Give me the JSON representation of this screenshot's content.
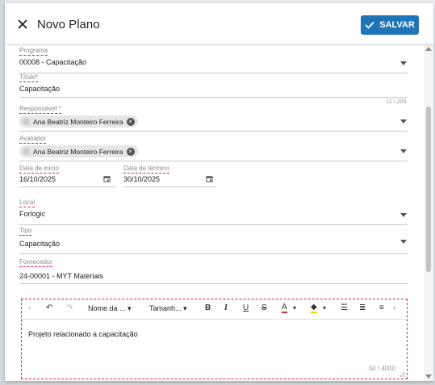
{
  "dialog": {
    "title": "Novo Plano",
    "save_label": "SALVAR",
    "colors": {
      "primary": "#1f73b7",
      "highlight": "#e0195a"
    }
  },
  "form": {
    "programa": {
      "label": "Programa",
      "value": "00008 - Capacitação"
    },
    "titulo": {
      "label": "Título*",
      "value": "Capacitação",
      "counter": "12 / 200"
    },
    "responsavel": {
      "label": "Responsável *",
      "chip": "Ana Beatriz Monteiro Ferreira"
    },
    "avaliador": {
      "label": "Avaliador",
      "chip": "Ana Beatriz Monteiro Ferreira"
    },
    "data_inicio": {
      "label": "Data de início",
      "value": "16/10/2025"
    },
    "data_termino": {
      "label": "Data de término",
      "value": "30/10/2025"
    },
    "local": {
      "label": "Local",
      "value": "Forlogic"
    },
    "tipo": {
      "label": "Tipo",
      "value": "Capacitação"
    },
    "fornecedor": {
      "label": "Fornecedor",
      "value": "24-00001 - MYT Materiais"
    }
  },
  "editor": {
    "font_select": "Nome da ...",
    "size_select": "Tamanh...",
    "content": "Projeto relacionado a capacitação",
    "counter": "34 / 4000",
    "icons": [
      "chevron-left-icon",
      "undo-icon",
      "redo-icon",
      "bold-icon",
      "italic-icon",
      "underline-icon",
      "strikethrough-icon",
      "font-color-icon",
      "highlight-icon",
      "bullet-list-icon",
      "numbered-list-icon",
      "align-icon",
      "chevron-right-icon"
    ]
  }
}
